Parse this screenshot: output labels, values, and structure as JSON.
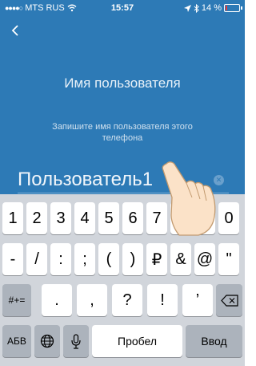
{
  "status_bar": {
    "carrier": "MTS RUS",
    "time": "15:57",
    "battery": "14 %",
    "battery_level": 0.14
  },
  "header": {
    "title": "Имя пользователя",
    "subtitle": "Запишите имя пользователя этого телефона"
  },
  "input": {
    "value": "Пользователь1"
  },
  "keyboard": {
    "row1": [
      "1",
      "2",
      "3",
      "4",
      "5",
      "6",
      "7",
      "8",
      "9",
      "0"
    ],
    "row2": [
      "-",
      "/",
      ":",
      ";",
      "(",
      ")",
      "₽",
      "&",
      "@",
      "\""
    ],
    "row3_left": "#+=",
    "row3": [
      ".",
      ",",
      "?",
      "!",
      "’"
    ],
    "row4_left": "АБВ",
    "space": "Пробел",
    "enter": "Ввод"
  },
  "colors": {
    "background": "#2d7ab6",
    "keyboard": "#d1d5db",
    "key": "#ffffff",
    "function_key": "#acb3bc"
  },
  "icons": [
    "chevron-left-icon",
    "wifi-icon",
    "location-icon",
    "bluetooth-icon",
    "battery-icon",
    "clear-icon",
    "backspace-icon",
    "globe-icon",
    "microphone-icon",
    "pointing-hand-icon"
  ]
}
